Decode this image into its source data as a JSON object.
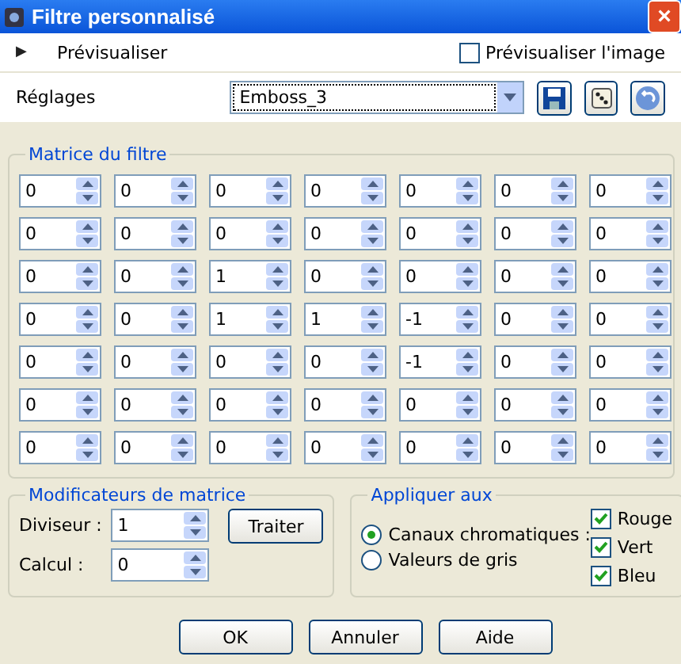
{
  "window": {
    "title": "Filtre personnalisé",
    "close": "×"
  },
  "preview": {
    "expander": "▶",
    "label": "Prévisualiser",
    "checkbox": {
      "label": "Prévisualiser l'image",
      "checked": false
    }
  },
  "presets": {
    "label": "Réglages",
    "value": "Emboss_3"
  },
  "matrix": {
    "title": "Matrice du filtre",
    "rows": [
      [
        "0",
        "0",
        "0",
        "0",
        "0",
        "0",
        "0"
      ],
      [
        "0",
        "0",
        "0",
        "0",
        "0",
        "0",
        "0"
      ],
      [
        "0",
        "0",
        "1",
        "0",
        "0",
        "0",
        "0"
      ],
      [
        "0",
        "0",
        "1",
        "1",
        "-1",
        "0",
        "0"
      ],
      [
        "0",
        "0",
        "0",
        "0",
        "-1",
        "0",
        "0"
      ],
      [
        "0",
        "0",
        "0",
        "0",
        "0",
        "0",
        "0"
      ],
      [
        "0",
        "0",
        "0",
        "0",
        "0",
        "0",
        "0"
      ]
    ]
  },
  "modifiers": {
    "title": "Modificateurs de matrice",
    "divisor": {
      "label": "Diviseur :",
      "value": "1"
    },
    "bias": {
      "label": "Calcul :",
      "value": "0"
    },
    "button": "Traiter"
  },
  "apply": {
    "title": "Appliquer aux",
    "radios": [
      {
        "label": "Canaux chromatiques :",
        "selected": true
      },
      {
        "label": "Valeurs de gris",
        "selected": false
      }
    ],
    "channels": [
      {
        "label": "Rouge",
        "checked": true
      },
      {
        "label": "Vert",
        "checked": true
      },
      {
        "label": "Bleu",
        "checked": true
      }
    ]
  },
  "buttons": [
    "OK",
    "Annuler",
    "Aide"
  ]
}
